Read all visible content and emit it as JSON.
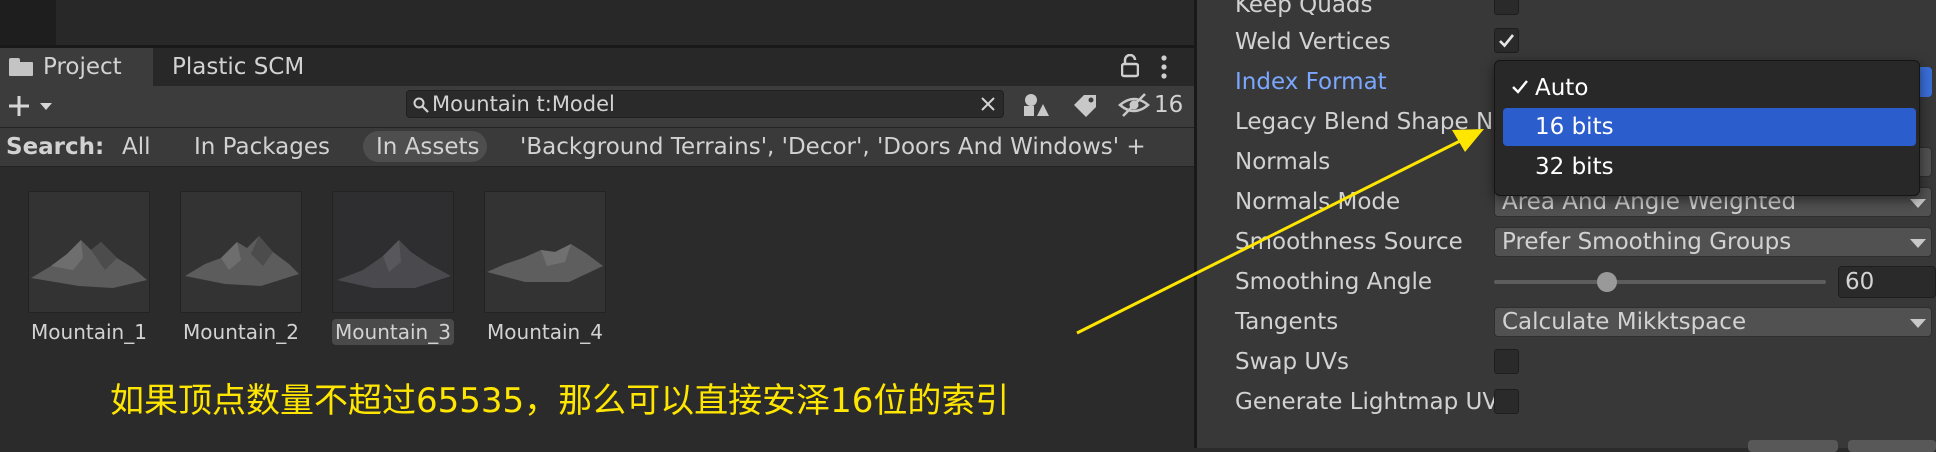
{
  "tabs": {
    "project": "Project",
    "plastic": "Plastic SCM"
  },
  "toolbar": {
    "search_value": "Mountain t:Model",
    "hidden_count": "16"
  },
  "search_scope": {
    "label": "Search:",
    "all": "All",
    "in_packages": "In Packages",
    "in_assets": "In Assets",
    "filters": "'Background Terrains', 'Decor', 'Doors And Windows' +"
  },
  "assets": [
    {
      "name": "Mountain_1"
    },
    {
      "name": "Mountain_2"
    },
    {
      "name": "Mountain_3"
    },
    {
      "name": "Mountain_4"
    }
  ],
  "annotation": {
    "text": "如果顶点数量不超过65535，那么可以直接安泽16位的索引",
    "color": "#ffe600"
  },
  "inspector": {
    "keep_quads": "Keep Quads",
    "weld_vertices": "Weld Vertices",
    "index_format": "Index Format",
    "legacy_blend": "Legacy Blend Shape N",
    "normals": "Normals",
    "normals_mode": "Normals Mode",
    "normals_mode_value": "Area And Angle Weighted",
    "smoothness_source": "Smoothness Source",
    "smoothness_source_value": "Prefer Smoothing Groups",
    "smoothing_angle": "Smoothing Angle",
    "smoothing_angle_value": "60",
    "tangents": "Tangents",
    "tangents_value": "Calculate Mikktspace",
    "swap_uvs": "Swap UVs",
    "generate_lightmap": "Generate Lightmap UV"
  },
  "index_format_menu": {
    "items": [
      "Auto",
      "16 bits",
      "32 bits"
    ],
    "checked": "Auto",
    "highlighted": "16 bits"
  },
  "colors": {
    "highlight": "#2c5dcd",
    "link_label": "#7aa7ff",
    "panel_bg": "#383838"
  }
}
